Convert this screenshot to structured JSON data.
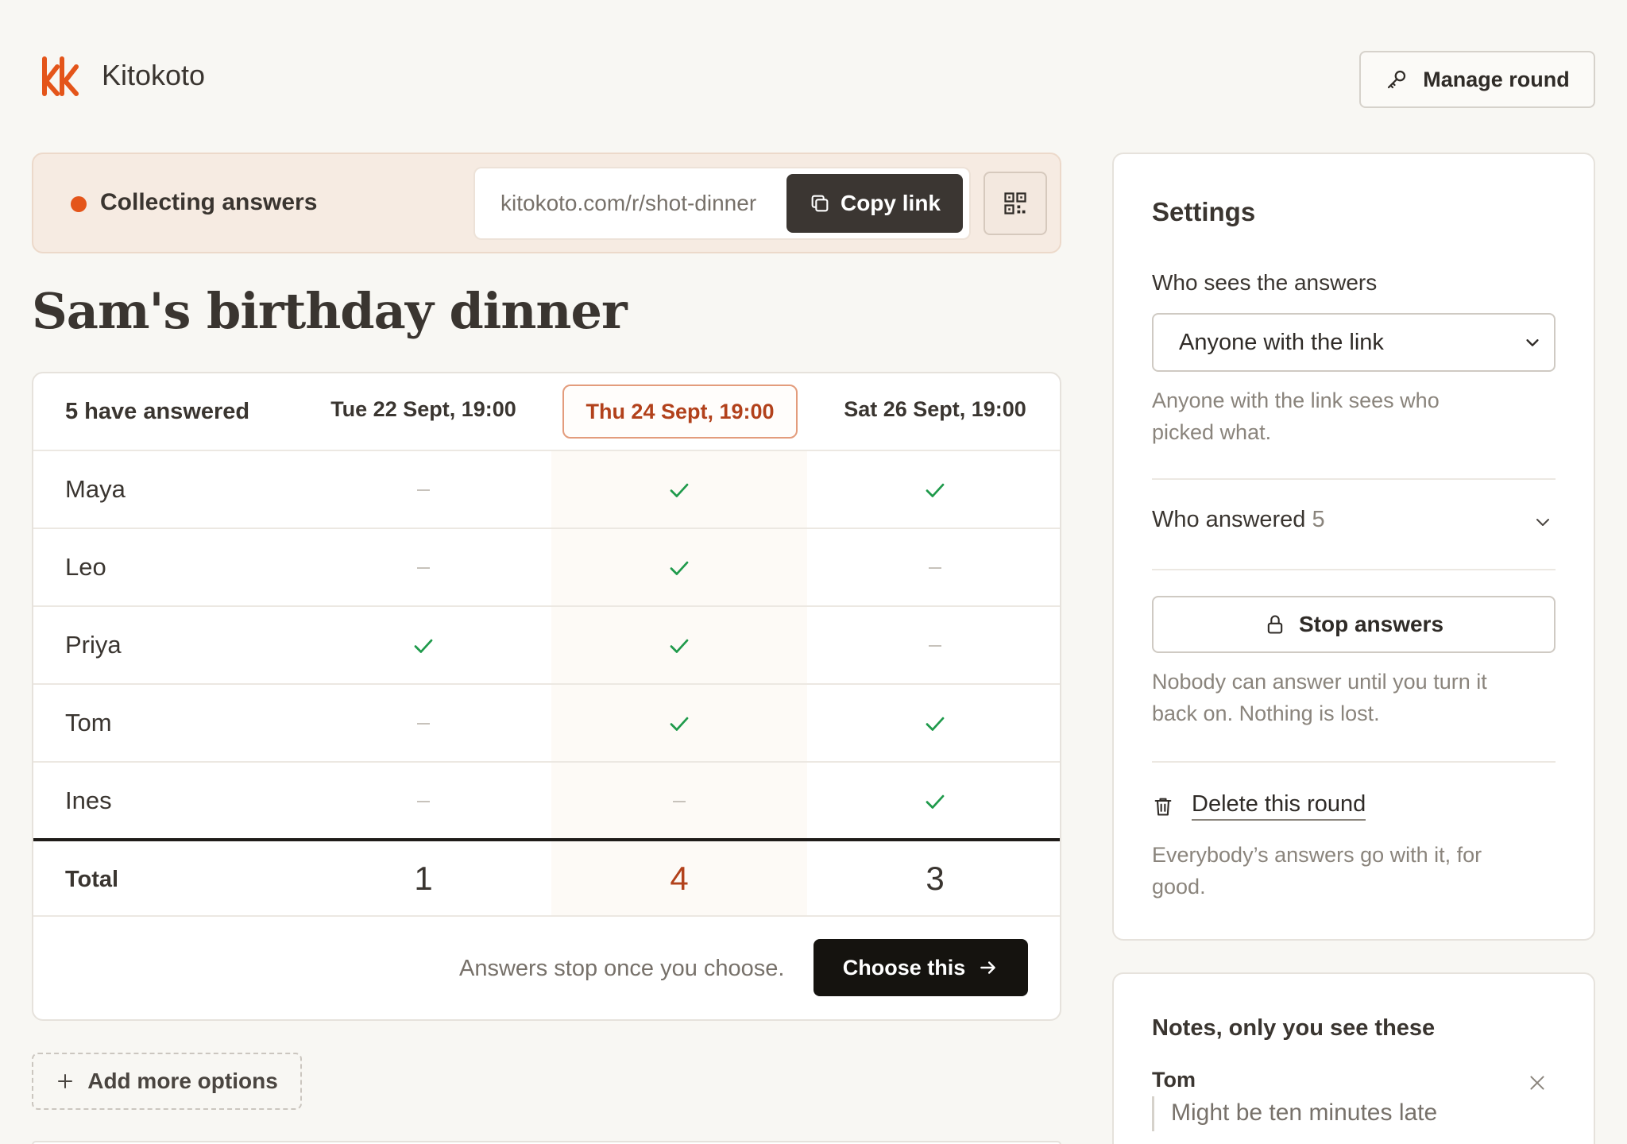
{
  "app": {
    "name": "Kitokoto",
    "manage_label": "Manage round",
    "brand_color": "#e4551a"
  },
  "banner": {
    "status": "Collecting answers",
    "link": "kitokoto.com/r/shot-dinner",
    "copy_label": "Copy link"
  },
  "page": {
    "title": "Sam's birthday dinner"
  },
  "table": {
    "answered_label": "5 have answered",
    "columns": [
      "Tue 22 Sept, 19:00",
      "Thu 24 Sept, 19:00",
      "Sat 26 Sept, 19:00"
    ],
    "highlighted_column": 1,
    "rows": [
      {
        "name": "Maya",
        "answers": [
          false,
          true,
          true
        ]
      },
      {
        "name": "Leo",
        "answers": [
          false,
          true,
          false
        ]
      },
      {
        "name": "Priya",
        "answers": [
          true,
          true,
          false
        ]
      },
      {
        "name": "Tom",
        "answers": [
          false,
          true,
          true
        ]
      },
      {
        "name": "Ines",
        "answers": [
          false,
          false,
          true
        ]
      }
    ],
    "total_label": "Total",
    "totals": [
      "1",
      "4",
      "3"
    ],
    "choose_note": "Answers stop once you choose.",
    "choose_label": "Choose this"
  },
  "add_options_label": "Add more options",
  "settings": {
    "title": "Settings",
    "visibility_label": "Who sees the answers",
    "visibility_value": "Anyone with the link",
    "visibility_help": "Anyone with the link sees who picked what.",
    "who_answered_label": "Who answered",
    "who_answered_count": "5",
    "stop_label": "Stop answers",
    "stop_help": "Nobody can answer until you turn it back on. Nothing is lost.",
    "delete_label": "Delete this round",
    "delete_help": "Everybody’s answers go with it, for good."
  },
  "notes": {
    "title": "Notes, only you see these",
    "items": [
      {
        "author": "Tom",
        "text": "Might be ten minutes late"
      }
    ]
  }
}
